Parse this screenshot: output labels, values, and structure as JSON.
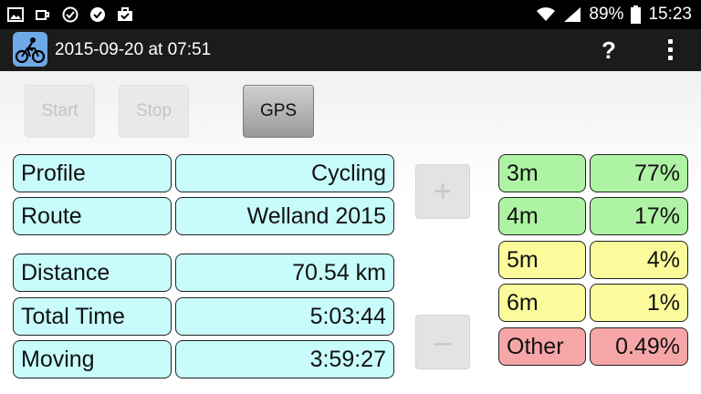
{
  "status_bar": {
    "battery_percent": "89%",
    "time": "15:23",
    "left_icons": [
      "image-icon",
      "coffee-cup-icon",
      "check-circle-outline-icon",
      "check-circle-filled-icon",
      "briefcase-check-icon"
    ],
    "right_icons": [
      "wifi-icon",
      "signal-icon",
      "battery-icon"
    ]
  },
  "action_bar": {
    "app_icon": "cyclist-icon",
    "title": "2015-09-20 at 07:51",
    "help_label": "?",
    "overflow_icon": "overflow-menu-icon"
  },
  "controls": {
    "start_label": "Start",
    "stop_label": "Stop",
    "gps_label": "GPS"
  },
  "info": {
    "profile": {
      "label": "Profile",
      "value": "Cycling"
    },
    "route": {
      "label": "Route",
      "value": "Welland 2015"
    }
  },
  "stats": {
    "distance": {
      "label": "Distance",
      "value": "70.54 km"
    },
    "total_time": {
      "label": "Total Time",
      "value": "5:03:44"
    },
    "moving": {
      "label": "Moving",
      "value": "3:59:27"
    }
  },
  "steppers": {
    "plus": "+",
    "minus": "–"
  },
  "accuracy": [
    {
      "label": "3m",
      "value": "77%",
      "color": "#aef3a3"
    },
    {
      "label": "4m",
      "value": "17%",
      "color": "#aef3a3"
    },
    {
      "label": "5m",
      "value": "4%",
      "color": "#fbfb9c"
    },
    {
      "label": "6m",
      "value": "1%",
      "color": "#fbfb9c"
    },
    {
      "label": "Other",
      "value": "0.49%",
      "color": "#f7a6a8"
    }
  ]
}
